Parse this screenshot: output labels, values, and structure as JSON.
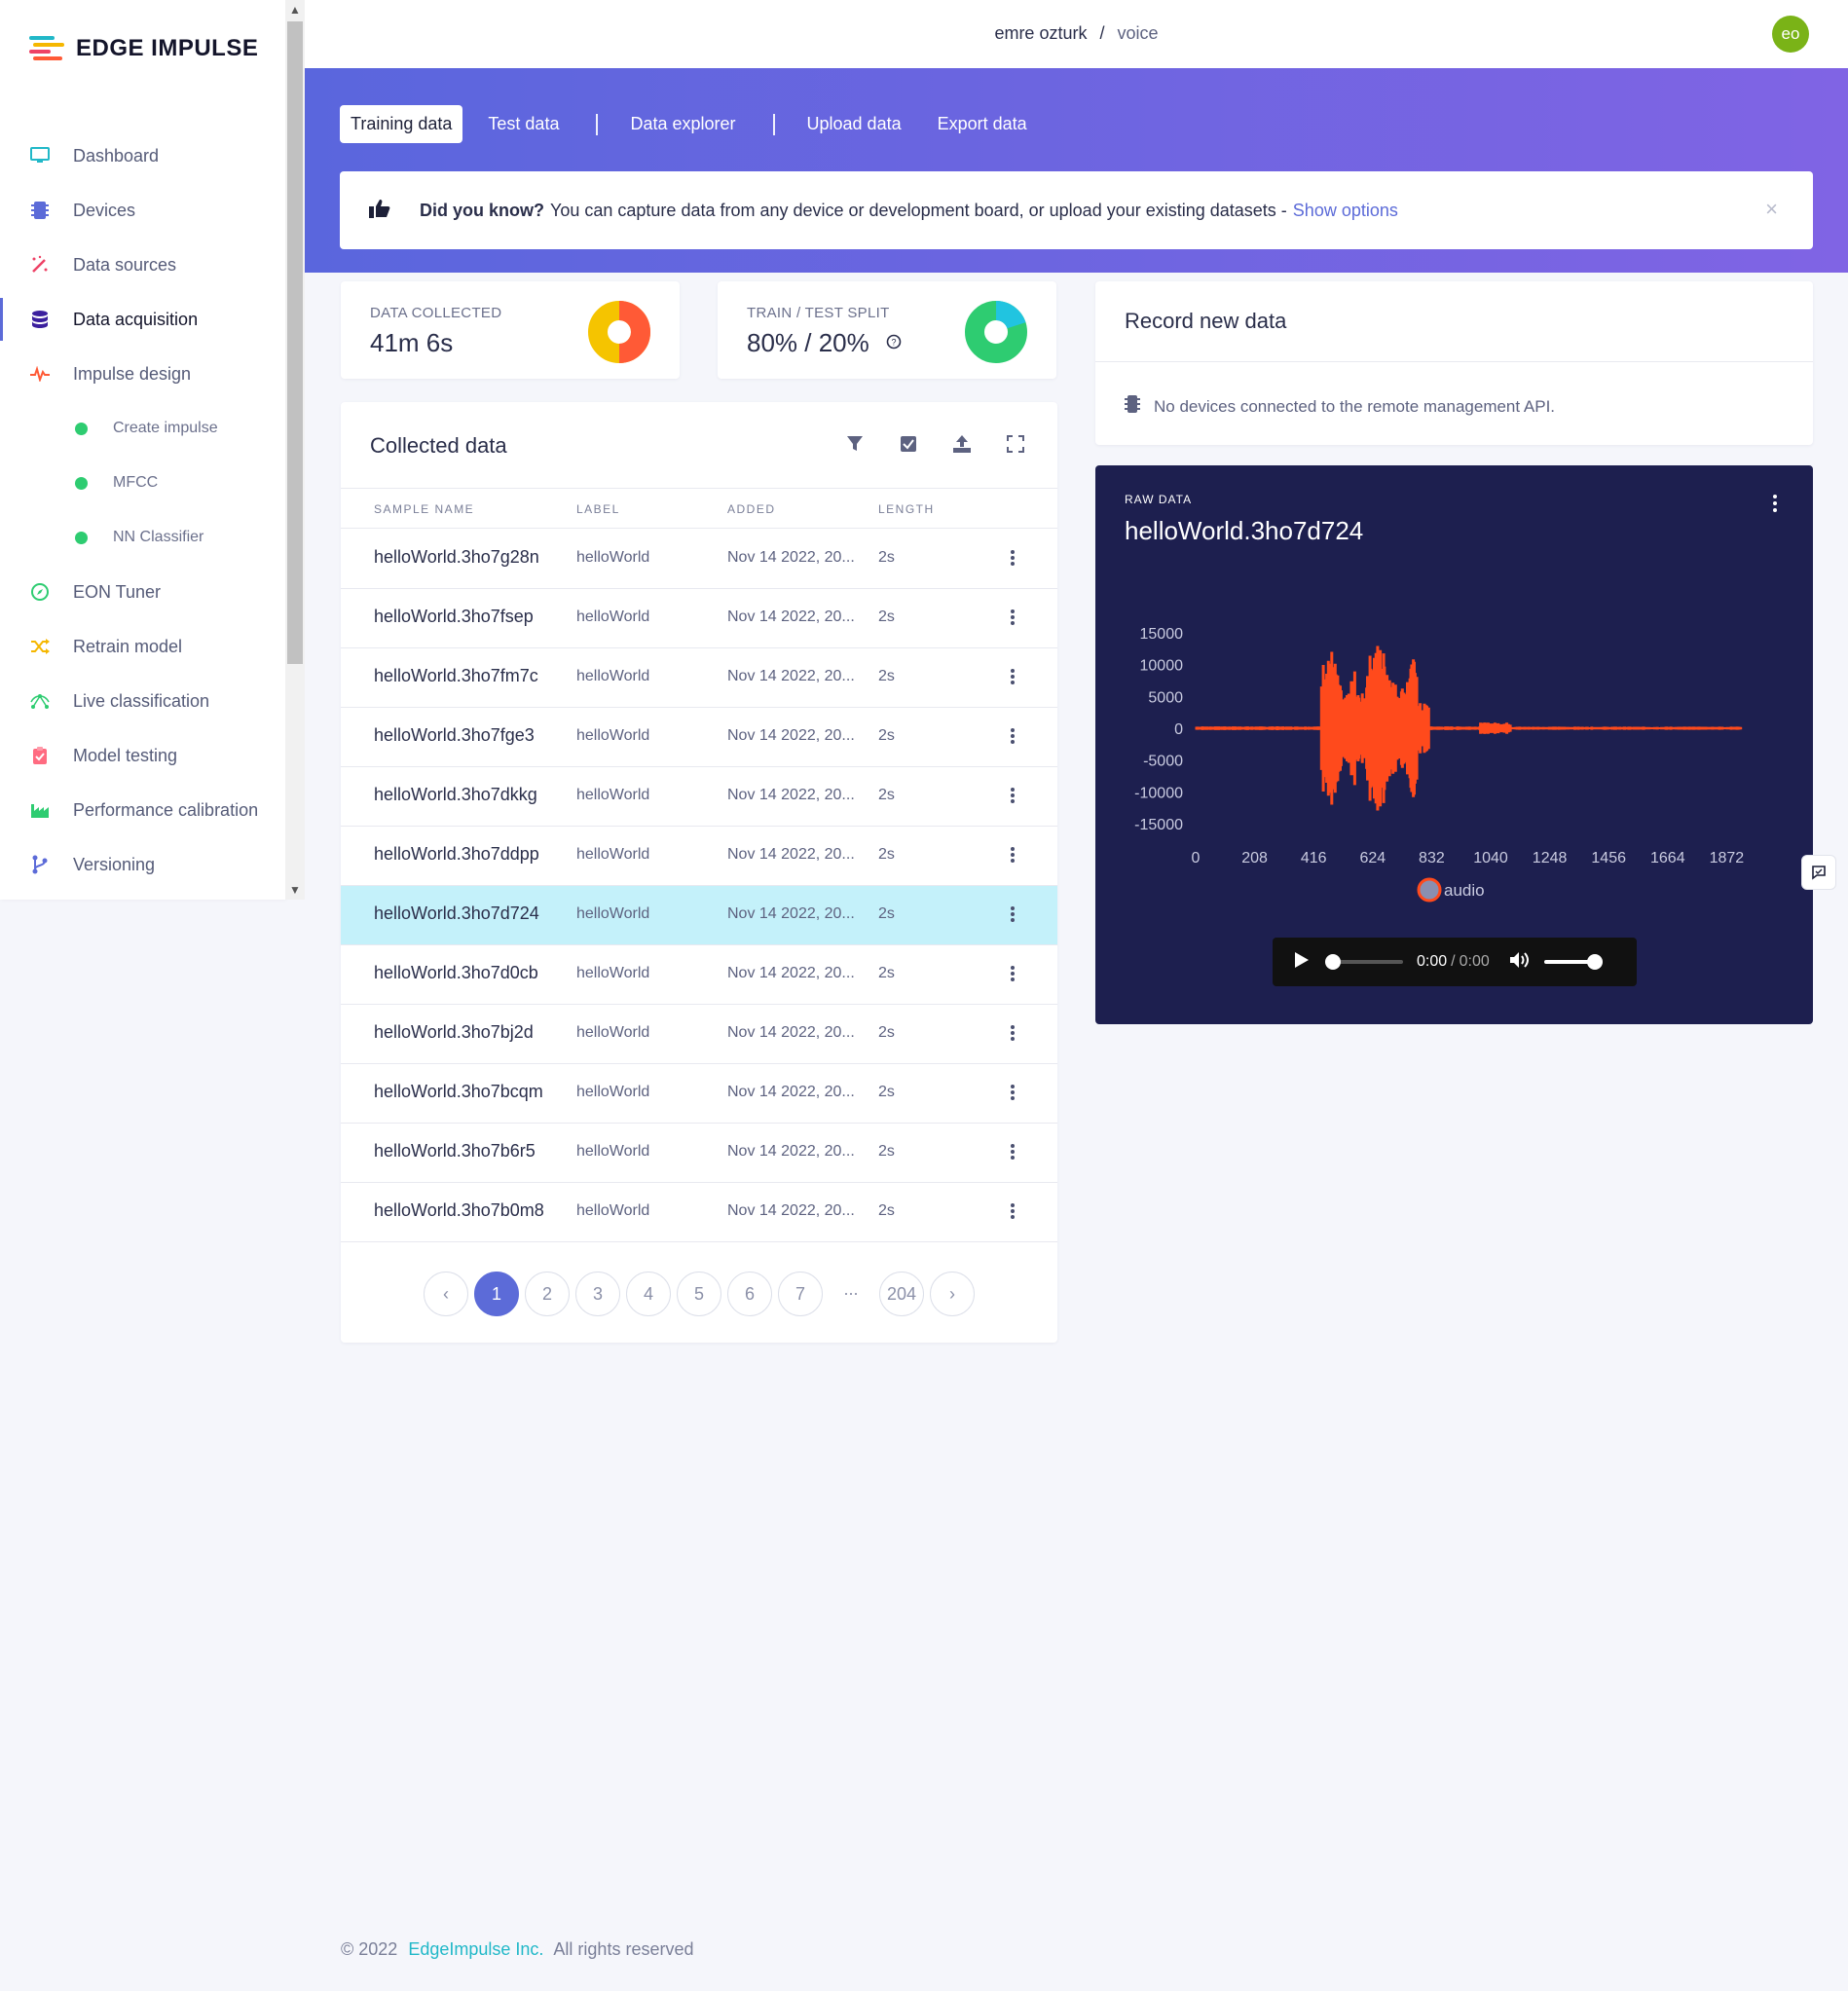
{
  "brand": {
    "name": "EDGE IMPULSE"
  },
  "sidebar": {
    "items": [
      {
        "label": "Dashboard",
        "icon": "monitor-icon",
        "color": "#21b8c8"
      },
      {
        "label": "Devices",
        "icon": "chip-icon",
        "color": "#5c6bd8"
      },
      {
        "label": "Data sources",
        "icon": "wand-icon",
        "color": "#ee4266"
      },
      {
        "label": "Data acquisition",
        "icon": "database-icon",
        "color": "#3b1f9e",
        "active": true
      },
      {
        "label": "Impulse design",
        "icon": "pulse-icon",
        "color": "#ff5a36"
      }
    ],
    "subitems": [
      {
        "label": "Create impulse"
      },
      {
        "label": "MFCC"
      },
      {
        "label": "NN Classifier"
      }
    ],
    "items2": [
      {
        "label": "EON Tuner",
        "icon": "compass-icon",
        "color": "#2ecc71"
      },
      {
        "label": "Retrain model",
        "icon": "shuffle-icon",
        "color": "#f5b700"
      },
      {
        "label": "Live classification",
        "icon": "graph-icon",
        "color": "#2ecc71"
      },
      {
        "label": "Model testing",
        "icon": "clipboard-icon",
        "color": "#ff6b81"
      },
      {
        "label": "Performance calibration",
        "icon": "factory-icon",
        "color": "#2ecc71"
      },
      {
        "label": "Versioning",
        "icon": "branch-icon",
        "color": "#5c6bd8"
      }
    ]
  },
  "header": {
    "user": "emre ozturk",
    "separator": "/",
    "project": "voice",
    "avatar": "eo"
  },
  "tabs": [
    "Training data",
    "Test data",
    "Data explorer",
    "Upload data",
    "Export data"
  ],
  "tip": {
    "bold": "Did you know?",
    "text": "You can capture data from any device or development board, or upload your existing datasets -",
    "link": "Show options",
    "close": "×"
  },
  "stats": {
    "collected": {
      "label": "DATA COLLECTED",
      "value": "41m 6s"
    },
    "split": {
      "label": "TRAIN / TEST SPLIT",
      "value": "80% / 20%",
      "train_percent": 80,
      "test_percent": 20
    }
  },
  "collected": {
    "title": "Collected data",
    "columns": [
      "SAMPLE NAME",
      "LABEL",
      "ADDED",
      "LENGTH"
    ],
    "rows": [
      {
        "name": "helloWorld.3ho7g28n",
        "label": "helloWorld",
        "added": "Nov 14 2022, 20...",
        "length": "2s"
      },
      {
        "name": "helloWorld.3ho7fsep",
        "label": "helloWorld",
        "added": "Nov 14 2022, 20...",
        "length": "2s"
      },
      {
        "name": "helloWorld.3ho7fm7c",
        "label": "helloWorld",
        "added": "Nov 14 2022, 20...",
        "length": "2s"
      },
      {
        "name": "helloWorld.3ho7fge3",
        "label": "helloWorld",
        "added": "Nov 14 2022, 20...",
        "length": "2s"
      },
      {
        "name": "helloWorld.3ho7dkkg",
        "label": "helloWorld",
        "added": "Nov 14 2022, 20...",
        "length": "2s"
      },
      {
        "name": "helloWorld.3ho7ddpp",
        "label": "helloWorld",
        "added": "Nov 14 2022, 20...",
        "length": "2s"
      },
      {
        "name": "helloWorld.3ho7d724",
        "label": "helloWorld",
        "added": "Nov 14 2022, 20...",
        "length": "2s",
        "selected": true
      },
      {
        "name": "helloWorld.3ho7d0cb",
        "label": "helloWorld",
        "added": "Nov 14 2022, 20...",
        "length": "2s"
      },
      {
        "name": "helloWorld.3ho7bj2d",
        "label": "helloWorld",
        "added": "Nov 14 2022, 20...",
        "length": "2s"
      },
      {
        "name": "helloWorld.3ho7bcqm",
        "label": "helloWorld",
        "added": "Nov 14 2022, 20...",
        "length": "2s"
      },
      {
        "name": "helloWorld.3ho7b6r5",
        "label": "helloWorld",
        "added": "Nov 14 2022, 20...",
        "length": "2s"
      },
      {
        "name": "helloWorld.3ho7b0m8",
        "label": "helloWorld",
        "added": "Nov 14 2022, 20...",
        "length": "2s"
      }
    ],
    "pagination": {
      "pages": [
        "1",
        "2",
        "3",
        "4",
        "5",
        "6",
        "7",
        "...",
        "204"
      ],
      "current": "1"
    }
  },
  "record": {
    "title": "Record new data",
    "message": "No devices connected to the remote management API."
  },
  "raw": {
    "label": "RAW DATA",
    "title": "helloWorld.3ho7d724",
    "audio_time": "0:00",
    "audio_duration": "0:00",
    "audio_sep": "/",
    "wave_color": "#ff4a1c"
  },
  "chart_data": {
    "type": "line",
    "series": [
      {
        "name": "audio"
      }
    ],
    "x_ticks": [
      "0",
      "208",
      "416",
      "624",
      "832",
      "1040",
      "1248",
      "1456",
      "1664",
      "1872"
    ],
    "y_ticks": [
      "15000",
      "10000",
      "5000",
      "0",
      "-5000",
      "-10000",
      "-15000"
    ],
    "ylim": [
      -15000,
      15000
    ],
    "xlim": [
      0,
      2000
    ],
    "legend": "bottom-center"
  },
  "footer": {
    "copyright": "© 2022",
    "company": "EdgeImpulse Inc.",
    "rights": "All rights reserved"
  }
}
